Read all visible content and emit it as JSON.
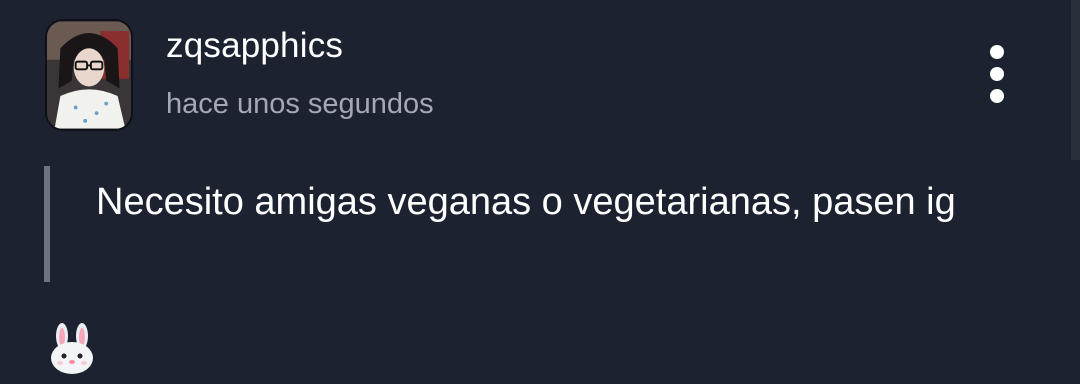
{
  "post": {
    "username": "zqsapphics",
    "timestamp": "hace unos segundos",
    "body": "Necesito amigas veganas o vegetarianas, pasen ig",
    "emoji": "rabbit-face"
  },
  "icons": {
    "more": "vertical-ellipsis-icon",
    "avatar": "user-avatar-photo"
  },
  "colors": {
    "background": "#1d2230",
    "text_primary": "#ffffff",
    "text_secondary": "#a3a8b4",
    "quote_bar": "#6d7383"
  }
}
